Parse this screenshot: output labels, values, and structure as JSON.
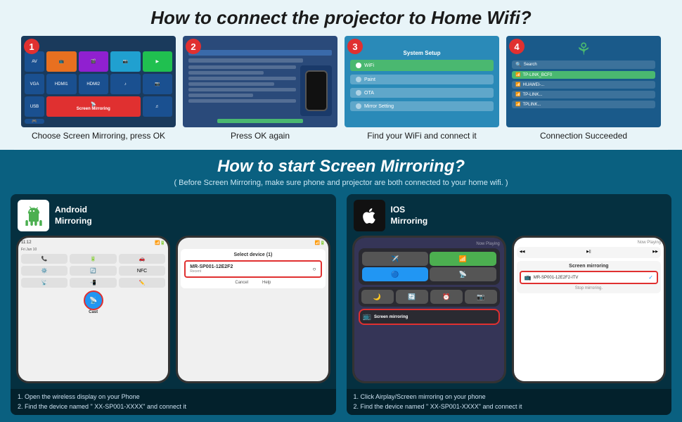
{
  "top": {
    "title": "How to connect the projector to Home Wifi?",
    "steps": [
      {
        "number": "1",
        "label": "Choose Screen Mirroring, press OK",
        "badge_color": "#e03030"
      },
      {
        "number": "2",
        "label": "Press OK again",
        "badge_color": "#e03030"
      },
      {
        "number": "3",
        "label": "Find your WiFi and connect it",
        "badge_color": "#e03030"
      },
      {
        "number": "4",
        "label": "Connection Succeeded",
        "badge_color": "#e03030"
      }
    ]
  },
  "bottom": {
    "title": "How to start Screen Mirroring?",
    "subtitle": "( Before Screen Mirroring, make sure phone and projector are both connected to your home wifi. )",
    "android": {
      "label_line1": "Android",
      "label_line2": "Mirroring",
      "select_device_title": "Select device (1)",
      "device_name": "MR-SP001-12E2F2",
      "device_sub": "Recent",
      "cast_label": "Cast",
      "cancel": "Cancel",
      "help": "Help",
      "footer_line1": "1. Open the wireless display on your Phone",
      "footer_line2": "2. Find the device named \" XX-SP001-XXXX\" and connect it"
    },
    "ios": {
      "label_line1": "IOS",
      "label_line2": "Mirroring",
      "screen_mirroring_label": "Screen mirroring",
      "device_name": "MR-SP001-12E2F2-ITV",
      "stop_mirroring": "Stop mirroring.",
      "footer_line1": "1. Click Airplay/Screen mirroring on your phone",
      "footer_line2": "2. Find the device named \" XX-SP001-XXXX\" and connect it"
    }
  }
}
